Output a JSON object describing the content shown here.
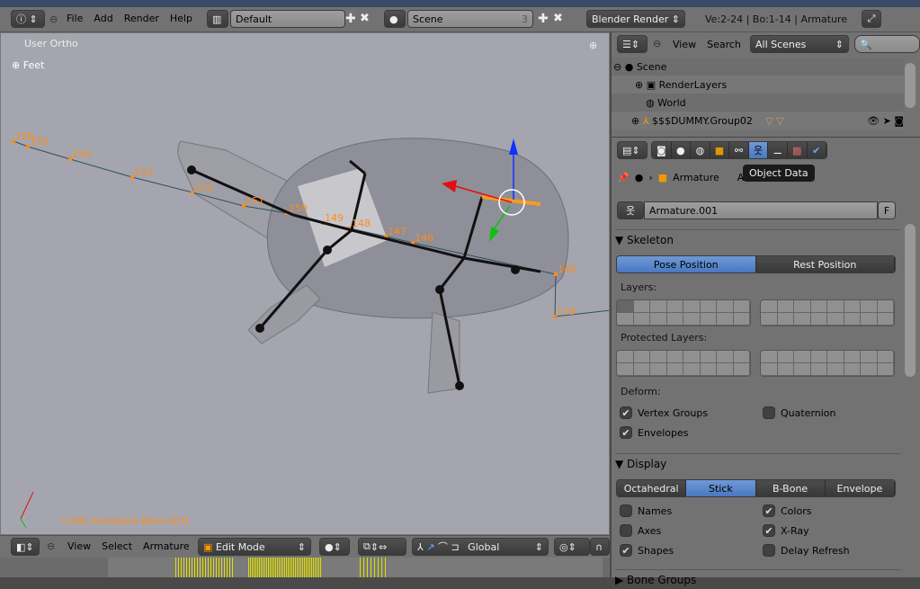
{
  "topbar": {
    "menus": [
      "File",
      "Add",
      "Render",
      "Help"
    ],
    "layout": "Default",
    "scene": "Scene",
    "scene_users": "3",
    "engine": "Blender Render",
    "stats": "Ve:2-24 | Bo:1-14 | Armature"
  },
  "viewport": {
    "view_label": "User Ortho",
    "units_label": "Feet",
    "status": "(146) Armature Bone.010",
    "path_frames": [
      "156",
      "155",
      "154",
      "153",
      "152",
      "151",
      "150",
      "149",
      "148",
      "147",
      "146",
      "140",
      "139"
    ],
    "colors": {
      "background": "#a4a5ae",
      "path_label": "#ff8c1a",
      "bone": "#111111",
      "selected_bone": "#ff9a1a"
    }
  },
  "view_header": {
    "menus": [
      "View",
      "Select",
      "Armature"
    ],
    "mode": "Edit Mode",
    "orientation": "Global"
  },
  "outliner": {
    "menus": [
      "View",
      "Search"
    ],
    "filter": "All Scenes",
    "items": [
      {
        "label": "Scene"
      },
      {
        "label": "RenderLayers"
      },
      {
        "label": "World"
      },
      {
        "label": "$$$DUMMY.Group02"
      }
    ]
  },
  "properties": {
    "tooltip": "Object Data",
    "breadcrumb": [
      "Armature",
      "Armature.001"
    ],
    "datablock": "Armature.001",
    "fake_user": "F",
    "skeleton": {
      "title": "Skeleton",
      "pose": "Pose Position",
      "rest": "Rest Position",
      "layers_label": "Layers:",
      "protected_label": "Protected Layers:",
      "deform_label": "Deform:",
      "vertex_groups": "Vertex Groups",
      "quaternion": "Quaternion",
      "envelopes": "Envelopes"
    },
    "display": {
      "title": "Display",
      "types": [
        "Octahedral",
        "Stick",
        "B-Bone",
        "Envelope"
      ],
      "active_type": "Stick",
      "names": "Names",
      "axes": "Axes",
      "shapes": "Shapes",
      "colors": "Colors",
      "xray": "X-Ray",
      "delay": "Delay Refresh"
    },
    "next_panel": "Bone Groups",
    "accent": "#5680c8"
  }
}
